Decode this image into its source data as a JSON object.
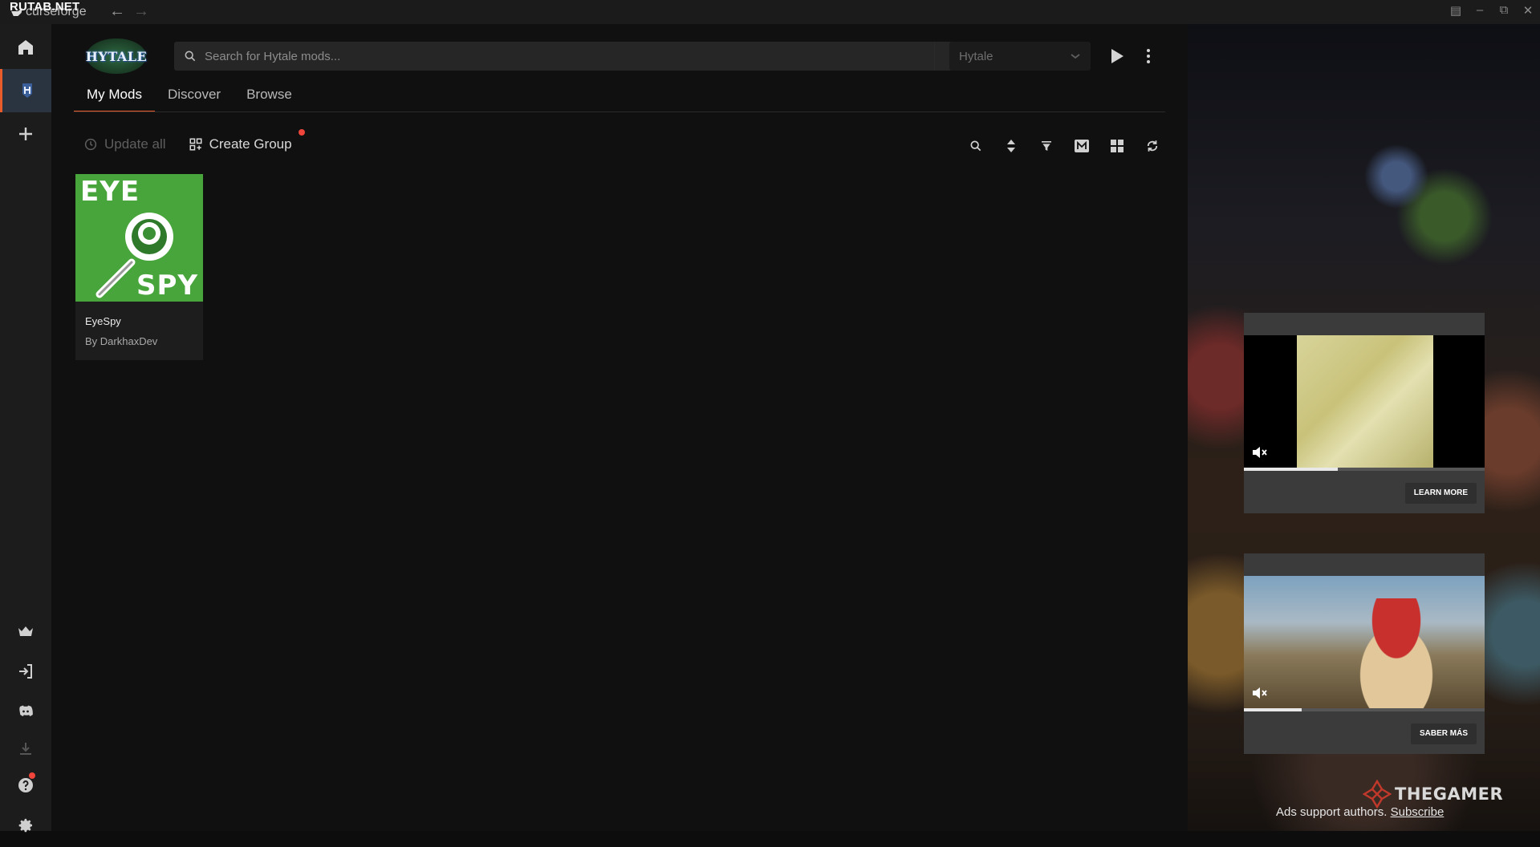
{
  "watermark": "RUTAB.NET",
  "app": {
    "name": "curseforge"
  },
  "search": {
    "placeholder": "Search for Hytale mods..."
  },
  "game_select": {
    "value": "Hytale"
  },
  "game_logo": "HYTALE",
  "tabs": [
    {
      "label": "My Mods",
      "active": true
    },
    {
      "label": "Discover",
      "active": false
    },
    {
      "label": "Browse",
      "active": false
    }
  ],
  "toolbar": {
    "update_all": "Update all",
    "create_group": "Create Group"
  },
  "mods": [
    {
      "thumb_top": "EYE",
      "thumb_bottom": "SPY",
      "name": "EyeSpy",
      "author": "By DarkhaxDev"
    }
  ],
  "ads": [
    {
      "button": "LEARN MORE",
      "progress": 0.39
    },
    {
      "button": "SABER MÁS",
      "progress": 0.24
    }
  ],
  "ad_brand": "THEGAMER",
  "ads_support": {
    "text": "Ads support authors.",
    "link": "Subscribe"
  },
  "colors": {
    "accent": "#e85b2a",
    "notification": "#f0453a",
    "rail_bg": "#1c1c1c",
    "main_bg": "#101010"
  },
  "icons": {
    "rail": [
      "home-icon",
      "hytale-game-icon",
      "add-icon",
      "crown-icon",
      "login-icon",
      "discord-icon",
      "download-icon",
      "help-icon",
      "settings-icon"
    ],
    "toolbar": [
      "search-icon",
      "sort-icon",
      "filter-icon",
      "m-view-icon",
      "grid-view-icon",
      "refresh-icon"
    ]
  }
}
